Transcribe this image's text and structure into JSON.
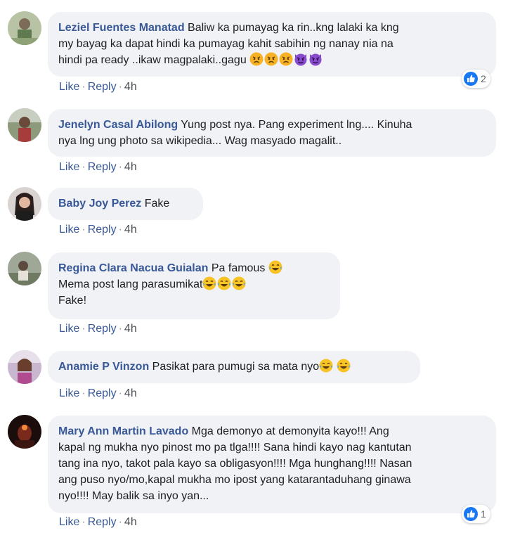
{
  "colors": {
    "name": "#385898",
    "bubble": "#f0f2f5",
    "like_blue": "#1877f2"
  },
  "actions": {
    "like": "Like",
    "reply": "Reply",
    "separator": "·"
  },
  "comments": [
    {
      "name": "Leziel Fuentes Manatad",
      "lines": [
        "Baliw ka pumayag ka rin..kng lalaki ka kng",
        "my bayag ka dapat hindi ka pumayag kahit sabihin ng nanay nia na",
        "hindi pa ready ..ikaw magpalaki..gagu"
      ],
      "emojis_last_line": [
        "angry-face",
        "angry-face",
        "angry-face",
        "purple-devil",
        "purple-devil"
      ],
      "time": "4h",
      "reactions": "2"
    },
    {
      "name": "Jenelyn Casal Abilong",
      "lines": [
        "Yung post nya. Pang experiment lng.... Kinuha",
        "nya lng ung photo sa wikipedia... Wag masyado magalit.."
      ],
      "time": "4h"
    },
    {
      "name": "Baby Joy Perez",
      "lines": [
        "Fake"
      ],
      "time": "4h"
    },
    {
      "name": "Regina Clara Nacua Guialan",
      "lines": [
        "Pa famous ",
        "Mema post lang parasumikat",
        "Fake!"
      ],
      "time": "4h"
    },
    {
      "name": "Anamie P Vinzon",
      "lines": [
        "Pasikat para pumugi sa mata nyo"
      ],
      "time": "4h"
    },
    {
      "name": "Mary Ann Martin Lavado",
      "lines": [
        "Mga demonyo at demonyita kayo!!! Ang",
        "kapal ng mukha nyo pinost mo pa tlga!!!! Sana hindi kayo nag kantutan",
        "tang ina nyo, takot pala kayo sa obligasyon!!!! Mga hunghang!!!! Nasan",
        "ang puso nyo/mo,kapal mukha mo ipost yang katarantaduhang ginawa",
        "nyo!!!! May balik sa inyo yan..."
      ],
      "time": "4h",
      "reactions": "1"
    }
  ]
}
